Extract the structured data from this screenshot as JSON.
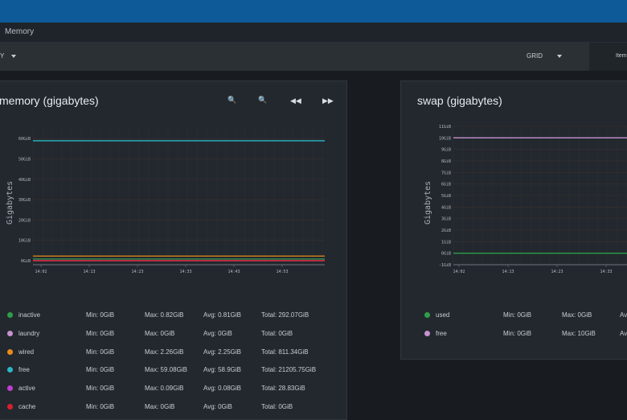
{
  "header": {
    "breadcrumb": "Memory"
  },
  "toolbar": {
    "left_value": "Y",
    "layout": "GRID",
    "items_label": "Item"
  },
  "charts": [
    {
      "title": "memory (gigabytes)",
      "ylabel": "Gigabytes",
      "y_ticks": [
        "60GiB",
        "50GiB",
        "40GiB",
        "30GiB",
        "20GiB",
        "10GiB",
        "0GiB"
      ],
      "x_ticks": [
        "14:02",
        "14:13",
        "14:23",
        "14:33",
        "14:43",
        "14:53"
      ],
      "legend": [
        {
          "name": "inactive",
          "color": "#2f9e4a",
          "min": "Min: 0GiB",
          "max": "Max: 0.82GiB",
          "avg": "Avg: 0.81GiB",
          "total": "Total: 292.07GiB"
        },
        {
          "name": "laundry",
          "color": "#c792d0",
          "min": "Min: 0GiB",
          "max": "Max: 0GiB",
          "avg": "Avg: 0GiB",
          "total": "Total: 0GiB"
        },
        {
          "name": "wired",
          "color": "#e88b1a",
          "min": "Min: 0GiB",
          "max": "Max: 2.26GiB",
          "avg": "Avg: 2.25GiB",
          "total": "Total: 811.34GiB"
        },
        {
          "name": "free",
          "color": "#2ab7c6",
          "min": "Min: 0GiB",
          "max": "Max: 59.08GiB",
          "avg": "Avg: 58.9GiB",
          "total": "Total: 21205.75GiB"
        },
        {
          "name": "active",
          "color": "#c03ed0",
          "min": "Min: 0GiB",
          "max": "Max: 0.09GiB",
          "avg": "Avg: 0.08GiB",
          "total": "Total: 28.83GiB"
        },
        {
          "name": "cache",
          "color": "#d6202e",
          "min": "Min: 0GiB",
          "max": "Max: 0GiB",
          "avg": "Avg: 0GiB",
          "total": "Total: 0GiB"
        }
      ]
    },
    {
      "title": "swap (gigabytes)",
      "ylabel": "Gigabytes",
      "y_ticks": [
        "11GiB",
        "10GiB",
        "9GiB",
        "8GiB",
        "7GiB",
        "6GiB",
        "5GiB",
        "4GiB",
        "3GiB",
        "2GiB",
        "1GiB",
        "0GiB",
        "-1GiB"
      ],
      "x_ticks": [
        "14:02",
        "14:13",
        "14:23",
        "14:33"
      ],
      "legend": [
        {
          "name": "used",
          "color": "#2f9e4a",
          "min": "Min: 0GiB",
          "max": "Max: 0GiB",
          "avg": "Av"
        },
        {
          "name": "free",
          "color": "#c792d0",
          "min": "Min: 0GiB",
          "max": "Max: 10GiB",
          "avg": "Av"
        }
      ]
    }
  ],
  "chart_data": [
    {
      "type": "line",
      "title": "memory (gigabytes)",
      "ylabel": "Gigabytes",
      "ylim": [
        -2,
        66
      ],
      "x": [
        "14:02",
        "14:13",
        "14:23",
        "14:33",
        "14:43",
        "14:53"
      ],
      "series": [
        {
          "name": "inactive",
          "color": "#2f9e4a",
          "values": [
            0.81,
            0.81,
            0.81,
            0.81,
            0.81,
            0.81
          ]
        },
        {
          "name": "laundry",
          "color": "#c792d0",
          "values": [
            0,
            0,
            0,
            0,
            0,
            0
          ]
        },
        {
          "name": "wired",
          "color": "#e88b1a",
          "values": [
            2.25,
            2.25,
            2.25,
            2.25,
            2.25,
            2.25
          ]
        },
        {
          "name": "free",
          "color": "#2ab7c6",
          "values": [
            58.9,
            58.9,
            58.9,
            58.9,
            58.9,
            58.9
          ]
        },
        {
          "name": "active",
          "color": "#c03ed0",
          "values": [
            0.08,
            0.08,
            0.08,
            0.08,
            0.08,
            0.08
          ]
        },
        {
          "name": "cache",
          "color": "#d6202e",
          "values": [
            0,
            0,
            0,
            0,
            0,
            0
          ]
        }
      ],
      "grid": true
    },
    {
      "type": "line",
      "title": "swap (gigabytes)",
      "ylabel": "Gigabytes",
      "ylim": [
        -1,
        11
      ],
      "x": [
        "14:02",
        "14:13",
        "14:23",
        "14:33"
      ],
      "series": [
        {
          "name": "used",
          "color": "#2f9e4a",
          "values": [
            0,
            0,
            0,
            0
          ]
        },
        {
          "name": "free",
          "color": "#c792d0",
          "values": [
            10,
            10,
            10,
            10
          ]
        }
      ],
      "grid": true
    }
  ]
}
